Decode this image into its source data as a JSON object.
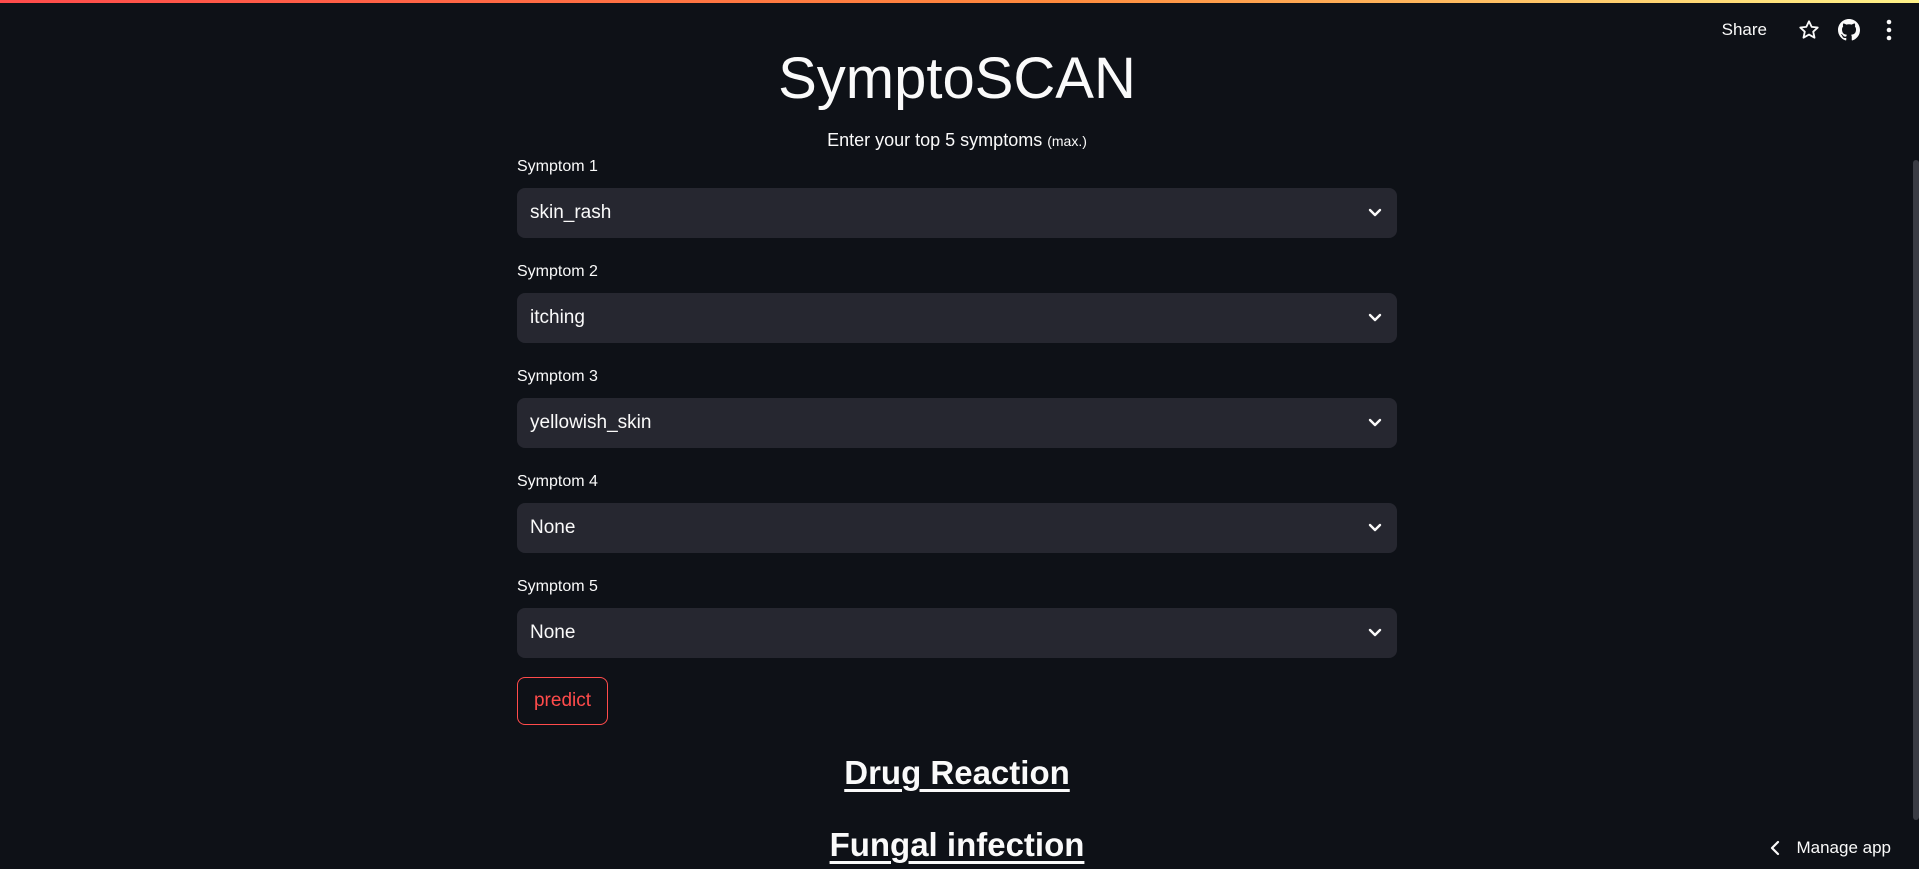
{
  "header": {
    "share_label": "Share",
    "icons": [
      "star-icon",
      "github-icon",
      "more-vertical-icon"
    ]
  },
  "app": {
    "title": "SymptoSCAN",
    "subtitle": "Enter your top 5 symptoms",
    "subtitle_note": "(max.)"
  },
  "symptoms": [
    {
      "label": "Symptom 1",
      "value": "skin_rash"
    },
    {
      "label": "Symptom 2",
      "value": "itching"
    },
    {
      "label": "Symptom 3",
      "value": "yellowish_skin"
    },
    {
      "label": "Symptom 4",
      "value": "None"
    },
    {
      "label": "Symptom 5",
      "value": "None"
    }
  ],
  "predict_label": "predict",
  "results": [
    "Drug Reaction",
    "Fungal infection"
  ],
  "footer": {
    "manage_app_label": "Manage app"
  },
  "colors": {
    "background": "#0e1117",
    "select_background": "#262730",
    "accent": "#ff4b4b",
    "text": "#fafafa"
  }
}
